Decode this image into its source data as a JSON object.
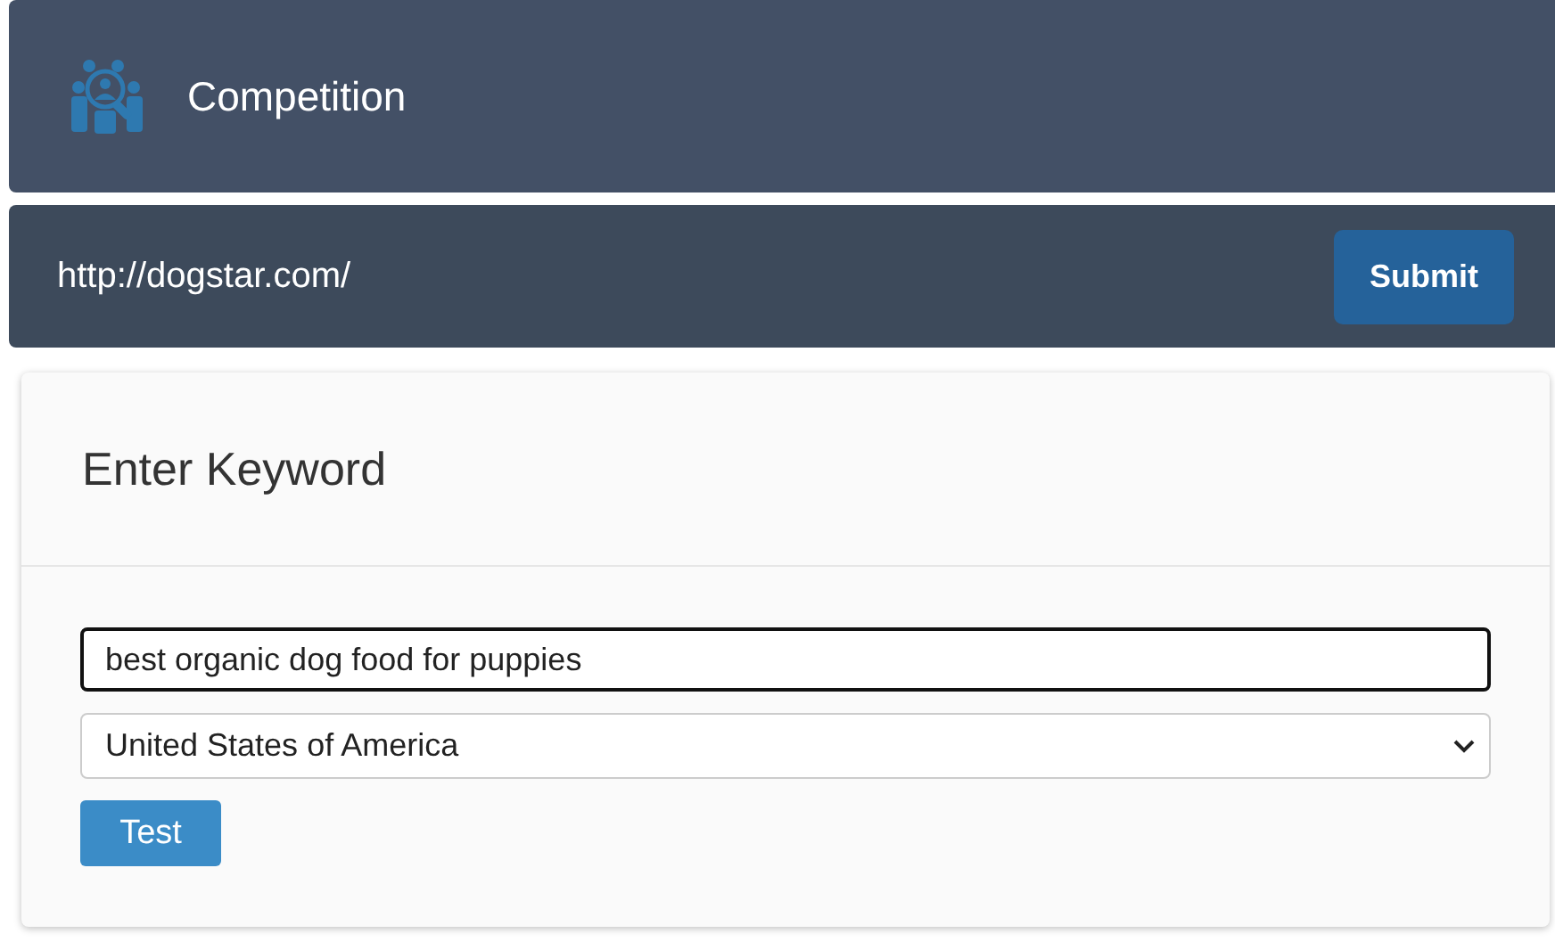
{
  "header": {
    "title": "Competition"
  },
  "url_bar": {
    "url": "http://dogstar.com/",
    "button": "Submit"
  },
  "card": {
    "title": "Enter Keyword",
    "keyword": {
      "value": "best organic dog food for puppies",
      "focused": true
    },
    "country": {
      "value": "United States of America"
    },
    "button": "Test"
  }
}
